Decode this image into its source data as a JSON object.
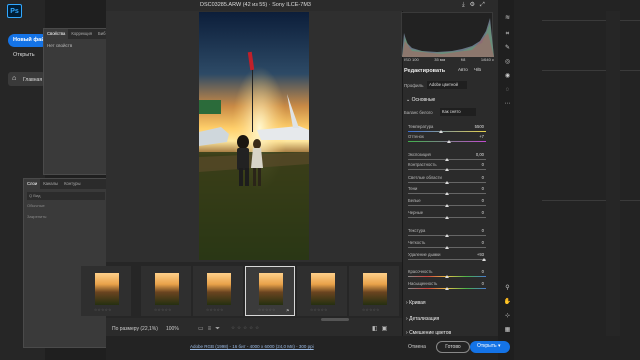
{
  "ps": {
    "logo": "Ps",
    "new_file": "Новый файл",
    "open": "Открыть",
    "home": "Главная"
  },
  "properties": {
    "tabs": [
      "Свойства",
      "Коррекция",
      "Биб"
    ],
    "body": "Нет свойств"
  },
  "layers": {
    "tabs": [
      "Слои",
      "Каналы",
      "Контуры"
    ],
    "search": "Q Вид",
    "mode": "Обычные",
    "lock": "Закрепить:"
  },
  "acr": {
    "title": "DSC03285.ARW (42 из 55)  ·  Sony ILCE-7M3",
    "histogram": {
      "iso": "ISO 100",
      "focal": "35 мм",
      "aperture": "f/8",
      "shutter": "1/640 с"
    },
    "edit_title": "Редактировать",
    "auto": "Авто",
    "bw": "Ч/Б",
    "profile_label": "Профиль",
    "profile_value": "Adobe цветной",
    "section_basic": "Основные",
    "wb_label": "Баланс белого",
    "wb_value": "Как снято",
    "sliders": [
      {
        "label": "Температура",
        "value": "5500",
        "pos": 0.42
      },
      {
        "label": "Оттенок",
        "value": "+7",
        "pos": 0.52
      },
      {
        "label": "Экспозиция",
        "value": "0,00",
        "pos": 0.5
      },
      {
        "label": "Контрастность",
        "value": "0",
        "pos": 0.5
      },
      {
        "label": "Светлые области",
        "value": "0",
        "pos": 0.5
      },
      {
        "label": "Тени",
        "value": "0",
        "pos": 0.5
      },
      {
        "label": "Белые",
        "value": "0",
        "pos": 0.5
      },
      {
        "label": "Черные",
        "value": "0",
        "pos": 0.5
      },
      {
        "label": "Текстура",
        "value": "0",
        "pos": 0.5
      },
      {
        "label": "Четкость",
        "value": "0",
        "pos": 0.5
      },
      {
        "label": "Удаление дымки",
        "value": "+93",
        "pos": 0.97
      },
      {
        "label": "Красочность",
        "value": "0",
        "pos": 0.5
      },
      {
        "label": "Насыщенность",
        "value": "0",
        "pos": 0.5
      }
    ],
    "sections": [
      "Кривая",
      "Детализация",
      "Смешение цветов"
    ],
    "fit_label": "По размеру (22,1%)",
    "zoom": "100%",
    "stars": "☆☆☆☆☆",
    "file_info": "Adobe RGB (1998) - 16 бит - 4000 x 6000 (24,0 Мп) - 300 ppi",
    "cancel": "Отмена",
    "ok": "Готово",
    "open_btn": "Открыть"
  },
  "colors": {
    "accent": "#1473e6",
    "panel": "#2b2b2b"
  }
}
